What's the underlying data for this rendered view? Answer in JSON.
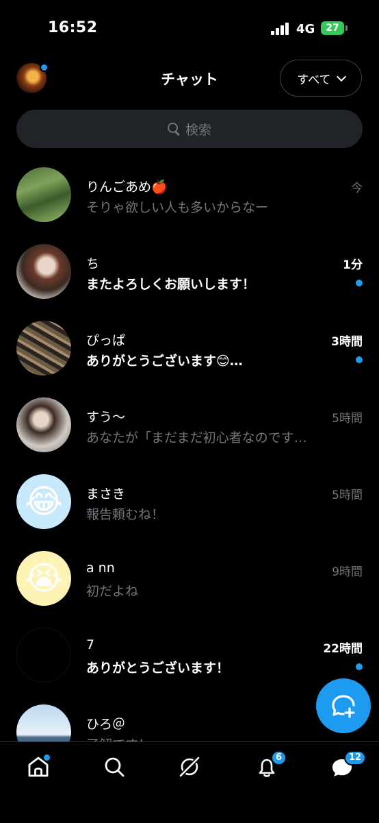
{
  "status_bar": {
    "time": "16:52",
    "network": "4G",
    "battery": "27"
  },
  "header": {
    "title": "チャット",
    "filter_label": "すべて"
  },
  "search": {
    "placeholder": "検索"
  },
  "chats": [
    {
      "name": "りんごあめ🍎",
      "preview": "そりゃ欲しい人も多いからなー",
      "timestamp": "今",
      "unread": false
    },
    {
      "name": "ち",
      "preview": "またよろしくお願いします！",
      "timestamp": "1分",
      "unread": true
    },
    {
      "name": "ぴっぱ",
      "preview": "ありがとうございます😊…",
      "timestamp": "3時間",
      "unread": true
    },
    {
      "name": "すう〜",
      "preview": "あなたが「まだまだ初心者なのです…",
      "timestamp": "5時間",
      "unread": false
    },
    {
      "name": "まさき",
      "preview": "報告頼むね！",
      "timestamp": "5時間",
      "unread": false
    },
    {
      "name": "a nn",
      "preview": "初だよね",
      "timestamp": "9時間",
      "unread": false
    },
    {
      "name": "7",
      "preview": "ありがとうございます！",
      "timestamp": "22時間",
      "unread": true
    },
    {
      "name": "ひろ＠",
      "preview": "了解です！",
      "timestamp": "",
      "unread": false
    }
  ],
  "tab_bar": {
    "notifications_badge": "6",
    "messages_badge": "12"
  },
  "colors": {
    "accent": "#1d9bf0",
    "background": "#000000",
    "muted_text": "#71767b",
    "battery_green": "#34c759"
  },
  "icons": [
    "home-icon",
    "search-icon",
    "grok-icon",
    "bell-icon",
    "messages-icon",
    "new-message-icon",
    "chevron-down-icon"
  ]
}
